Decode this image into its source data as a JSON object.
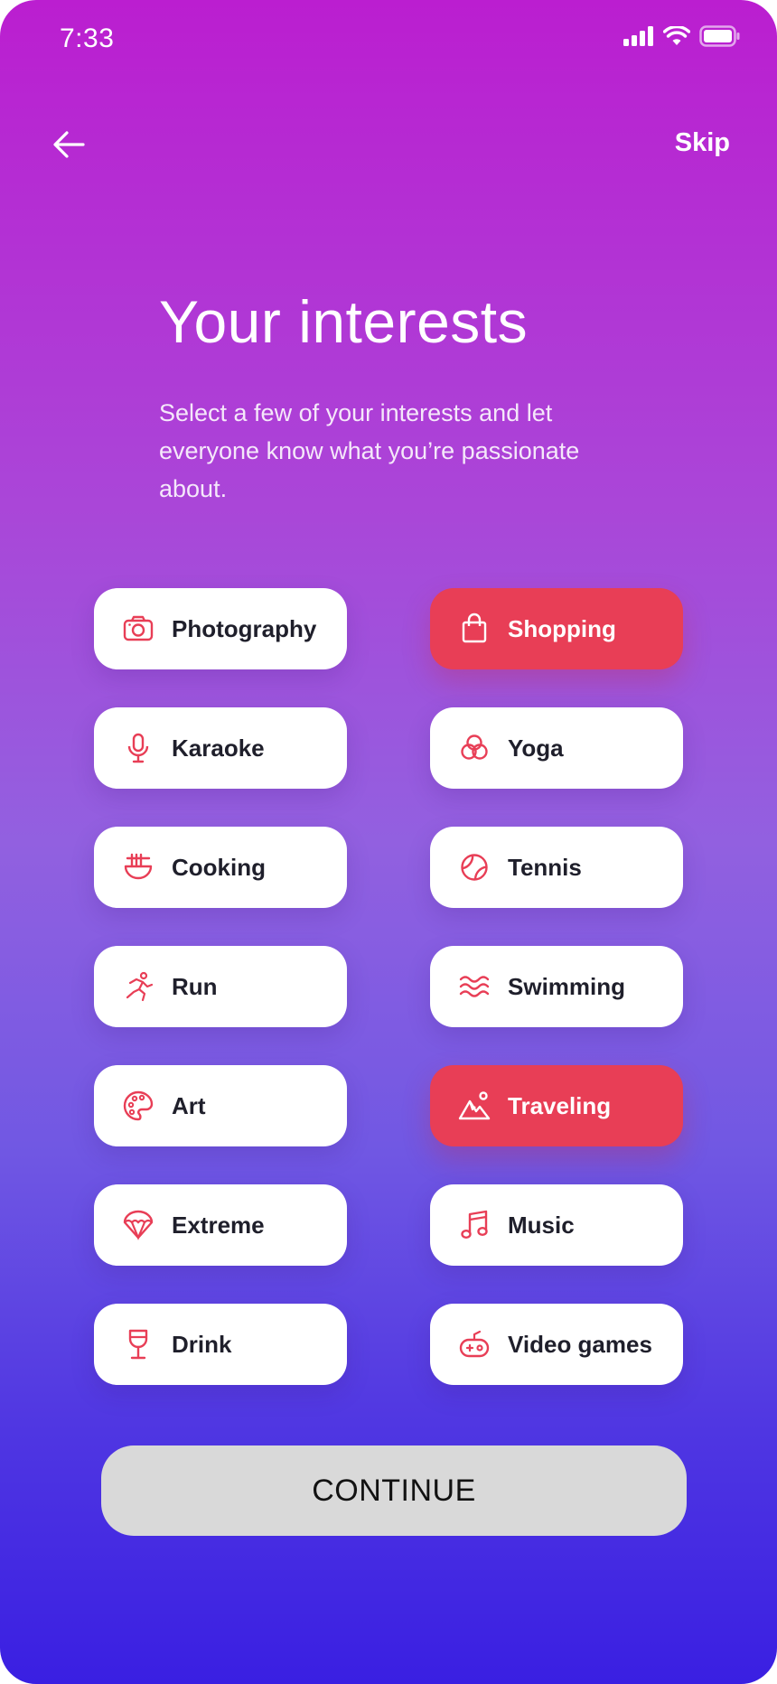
{
  "status_bar": {
    "time": "7:33"
  },
  "header": {
    "skip_label": "Skip"
  },
  "title": "Your interests",
  "subtitle": "Select a few of your interests and let everyone know what you’re passionate about.",
  "colors": {
    "accent": "#e83e56",
    "chip_bg": "#ffffff",
    "button_bg": "#d9d9d9"
  },
  "interests": [
    {
      "label": "Photography",
      "icon": "camera-icon",
      "selected": false
    },
    {
      "label": "Shopping",
      "icon": "shopping-bag-icon",
      "selected": true
    },
    {
      "label": "Karaoke",
      "icon": "microphone-icon",
      "selected": false
    },
    {
      "label": "Yoga",
      "icon": "yoga-circles-icon",
      "selected": false
    },
    {
      "label": "Cooking",
      "icon": "noodle-bowl-icon",
      "selected": false
    },
    {
      "label": "Tennis",
      "icon": "tennis-ball-icon",
      "selected": false
    },
    {
      "label": "Run",
      "icon": "runner-icon",
      "selected": false
    },
    {
      "label": "Swimming",
      "icon": "waves-icon",
      "selected": false
    },
    {
      "label": "Art",
      "icon": "palette-icon",
      "selected": false
    },
    {
      "label": "Traveling",
      "icon": "mountain-sun-icon",
      "selected": true
    },
    {
      "label": "Extreme",
      "icon": "parachute-icon",
      "selected": false
    },
    {
      "label": "Music",
      "icon": "music-note-icon",
      "selected": false
    },
    {
      "label": "Drink",
      "icon": "wine-glass-icon",
      "selected": false
    },
    {
      "label": "Video games",
      "icon": "gamepad-icon",
      "selected": false
    }
  ],
  "continue_label": "CONTINUE"
}
